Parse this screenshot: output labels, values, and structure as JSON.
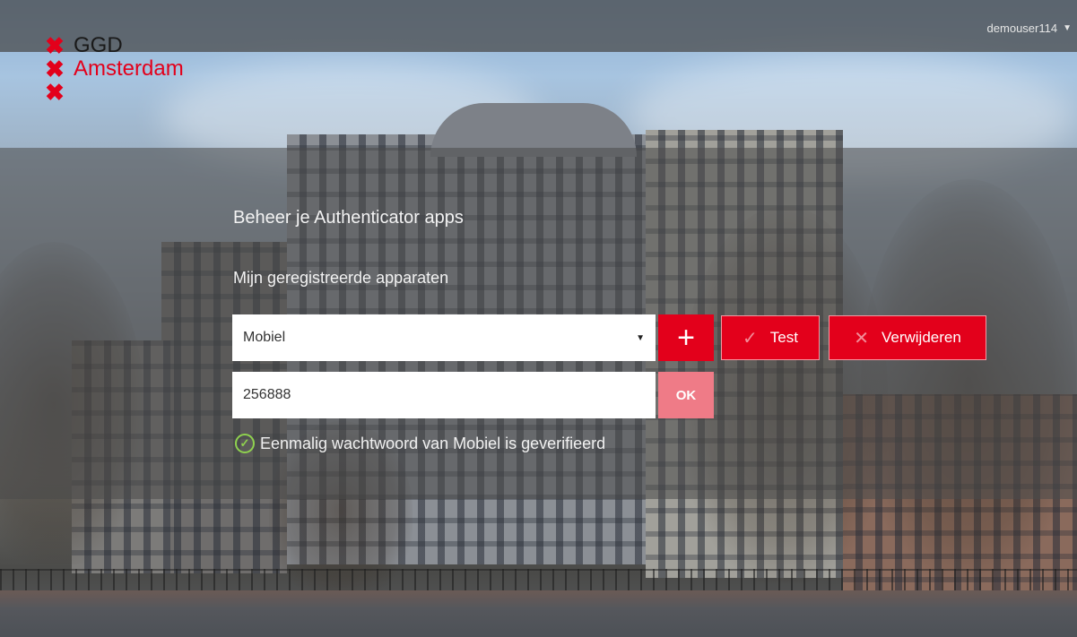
{
  "user_menu": {
    "username": "demouser114"
  },
  "logo": {
    "line1": "GGD",
    "line2": "Amsterdam",
    "mark": "✖"
  },
  "panel": {
    "title": "Beheer je Authenticator apps",
    "subtitle": "Mijn geregistreerde apparaten",
    "device_select": {
      "selected": "Mobiel"
    },
    "buttons": {
      "add": "+",
      "test": "Test",
      "remove": "Verwijderen",
      "ok": "OK"
    },
    "code_input": {
      "value": "256888"
    },
    "status_message": "Eenmalig wachtwoord van Mobiel is geverifieerd"
  },
  "colors": {
    "accent": "#e3001b",
    "ok_button": "#ef7b87",
    "success": "#8fd14f"
  },
  "icons": {
    "add": "plus-icon",
    "test": "check-icon",
    "remove": "x-icon",
    "status": "check-circle-icon",
    "user_menu": "caret-down-icon",
    "select": "caret-down-icon"
  }
}
